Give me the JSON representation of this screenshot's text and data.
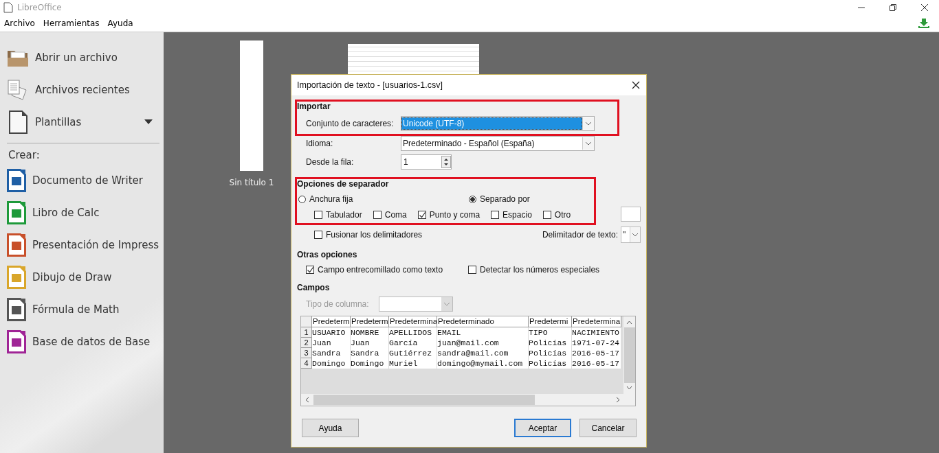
{
  "window": {
    "title": "LibreOffice"
  },
  "menu": [
    "Archivo",
    "Herramientas",
    "Ayuda"
  ],
  "sidebar": {
    "actions": [
      {
        "label": "Abrir un archivo",
        "dropdown": false
      },
      {
        "label": "Archivos recientes",
        "dropdown": false
      },
      {
        "label": "Plantillas",
        "dropdown": true
      }
    ],
    "create_label": "Crear:",
    "create": [
      {
        "label": "Documento de Writer",
        "color": "#1f5fa5"
      },
      {
        "label": "Libro de Calc",
        "color": "#1e9a3a"
      },
      {
        "label": "Presentación de Impress",
        "color": "#c8502a"
      },
      {
        "label": "Dibujo de Draw",
        "color": "#d9a62a"
      },
      {
        "label": "Fórmula de Math",
        "color": "#555555"
      },
      {
        "label": "Base de datos de Base",
        "color": "#a02596"
      }
    ]
  },
  "documents": [
    {
      "caption": "Sin título 1"
    }
  ],
  "dialog": {
    "title": "Importación de texto - [usuarios-1.csv]",
    "import": {
      "heading": "Importar",
      "highlighted": true,
      "charset": {
        "label": "Conjunto de caracteres:",
        "value": "Unicode (UTF-8)",
        "focused": true
      },
      "language": {
        "label": "Idioma:",
        "value": "Predeterminado - Español (España)"
      },
      "from_row": {
        "label": "Desde la fila:",
        "value": "1"
      }
    },
    "separator": {
      "heading": "Opciones de separador",
      "highlighted": true,
      "modes": [
        {
          "label": "Anchura fija",
          "selected": false
        },
        {
          "label": "Separado por",
          "selected": true
        }
      ],
      "delimiters": [
        {
          "label": "Tabulador",
          "checked": false
        },
        {
          "label": "Coma",
          "checked": false
        },
        {
          "label": "Punto y coma",
          "checked": true
        },
        {
          "label": "Espacio",
          "checked": false
        },
        {
          "label": "Otro",
          "checked": false
        }
      ],
      "merge": {
        "label": "Fusionar los delimitadores",
        "checked": false
      },
      "text_delimiter": {
        "label": "Delimitador de texto:",
        "value": "\""
      }
    },
    "other": {
      "heading": "Otras opciones",
      "options": [
        {
          "label": "Campo entrecomillado como texto",
          "checked": true
        },
        {
          "label": "Detectar los números especiales",
          "checked": false
        }
      ]
    },
    "fields": {
      "heading": "Campos",
      "column_type": {
        "label": "Tipo de columna:",
        "disabled": true
      },
      "columns": [
        "Predeterm",
        "Predeterm",
        "Predetermina",
        "Predeterminado",
        "Predetermi",
        "Predetermina"
      ],
      "rows": [
        {
          "number": "1",
          "cells": [
            "USUARIO",
            "NOMBRE",
            "APELLIDOS",
            "EMAIL",
            "TIPO",
            "NACIMIENTO"
          ]
        },
        {
          "number": "2",
          "cells": [
            "Juan",
            "Juan",
            "García",
            "juan@mail.com",
            "Policías",
            "1971-07-24"
          ]
        },
        {
          "number": "3",
          "cells": [
            "Sandra",
            "Sandra",
            "Gutiérrez",
            "sandra@mail.com",
            "Policías",
            "2016-05-17"
          ]
        },
        {
          "number": "4",
          "cells": [
            "Domingo",
            "Domingo",
            "Muriel",
            "domingo@mymail.com",
            "Policías",
            "2016-05-17"
          ]
        }
      ]
    },
    "buttons": [
      {
        "label": "Ayuda",
        "default": false
      },
      {
        "label": "Aceptar",
        "default": true
      },
      {
        "label": "Cancelar",
        "default": false
      }
    ]
  }
}
